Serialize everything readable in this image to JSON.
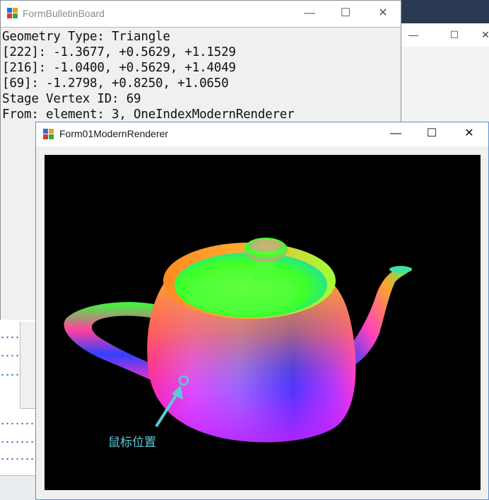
{
  "bulletin_window": {
    "title": "FormBulletinBoard",
    "lines": [
      "Geometry Type: Triangle",
      "[222]: -1.3677, +0.5629, +1.1529",
      "[216]: -1.0400, +0.5629, +1.4049",
      "[69]: -1.2798, +0.8250, +1.0650",
      "Stage Vertex ID: 69",
      "From: element: 3, OneIndexModernRenderer"
    ],
    "minimize_glyph": "—",
    "maximize_glyph": "☐",
    "close_glyph": "✕"
  },
  "renderer_window": {
    "title": "Form01ModernRenderer",
    "minimize_glyph": "—",
    "maximize_glyph": "☐",
    "close_glyph": "✕",
    "annotation_label": "鼠标位置"
  },
  "background_window": {
    "minimize_glyph": "—",
    "maximize_glyph": "☐",
    "close_glyph": "✕"
  },
  "icons": {
    "app_icon": "form-app-icon",
    "cursor_marker": "mouse-position-marker-icon",
    "arrow": "annotation-arrow-icon"
  },
  "colors": {
    "canvas_background": "#000000",
    "annotation": "#5ec9d9",
    "renderer_border": "#5e8fd1"
  }
}
